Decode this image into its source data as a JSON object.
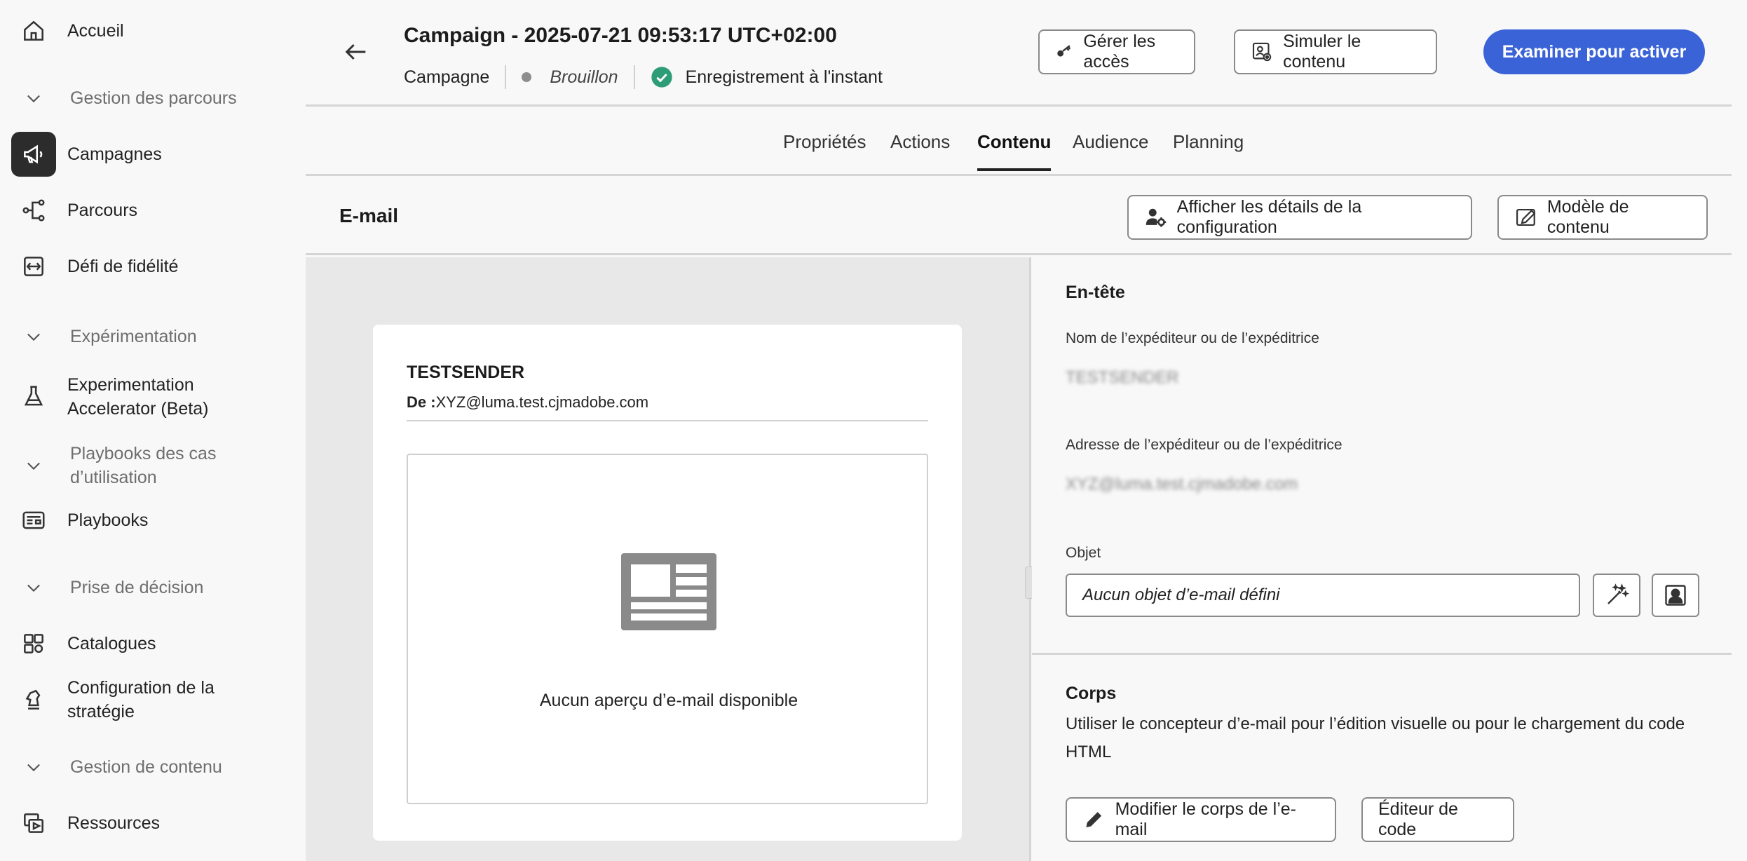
{
  "sidebar": {
    "home": "Accueil",
    "groups": {
      "journeys": "Gestion des parcours",
      "experimentation": "Expérimentation",
      "playbooks": "Playbooks des cas d’utilisation",
      "decisioning": "Prise de décision",
      "content": "Gestion de contenu"
    },
    "items": {
      "campaigns": "Campagnes",
      "journeys": "Parcours",
      "loyalty": "Défi de fidélité",
      "exp_accel": "Experimentation Accelerator (Beta)",
      "playbooks": "Playbooks",
      "catalogs": "Catalogues",
      "strategy": "Configuration de la stratégie",
      "resources": "Ressources"
    }
  },
  "header": {
    "title": "Campaign - 2025-07-21 09:53:17 UTC+02:00",
    "type": "Campagne",
    "status": "Brouillon",
    "saved": "Enregistrement à l'instant",
    "manage_access": "Gérer les accès",
    "simulate": "Simuler le contenu",
    "review": "Examiner pour activer"
  },
  "tabs": [
    "Propriétés",
    "Actions",
    "Contenu",
    "Audience",
    "Planning"
  ],
  "email_bar": {
    "title": "E-mail",
    "config_details": "Afficher les détails de la configuration",
    "content_template": "Modèle de contenu"
  },
  "preview": {
    "sender_name": "TESTSENDER",
    "from_label": "De :",
    "from_address": "XYZ@luma.test.cjmadobe.com",
    "no_preview": "Aucun aperçu d’e-mail disponible"
  },
  "settings": {
    "header_title": "En-tête",
    "sender_name_label": "Nom de l’expéditeur ou de l’expéditrice",
    "sender_name_value": "TESTSENDER",
    "sender_address_label": "Adresse de l’expéditeur ou de l’expéditrice",
    "sender_address_value": "XYZ@luma.test.cjmadobe.com",
    "subject_label": "Objet",
    "subject_placeholder": "Aucun objet d’e-mail défini",
    "body_title": "Corps",
    "body_desc": "Utiliser le concepteur d’e-mail pour l’édition visuelle ou pour le chargement du code HTML",
    "edit_body": "Modifier le corps de l’e-mail",
    "code_editor": "Éditeur de code"
  },
  "colors": {
    "primary": "#3b63d8",
    "success": "#2d9d78",
    "active_nav": "#2c2c2c"
  }
}
